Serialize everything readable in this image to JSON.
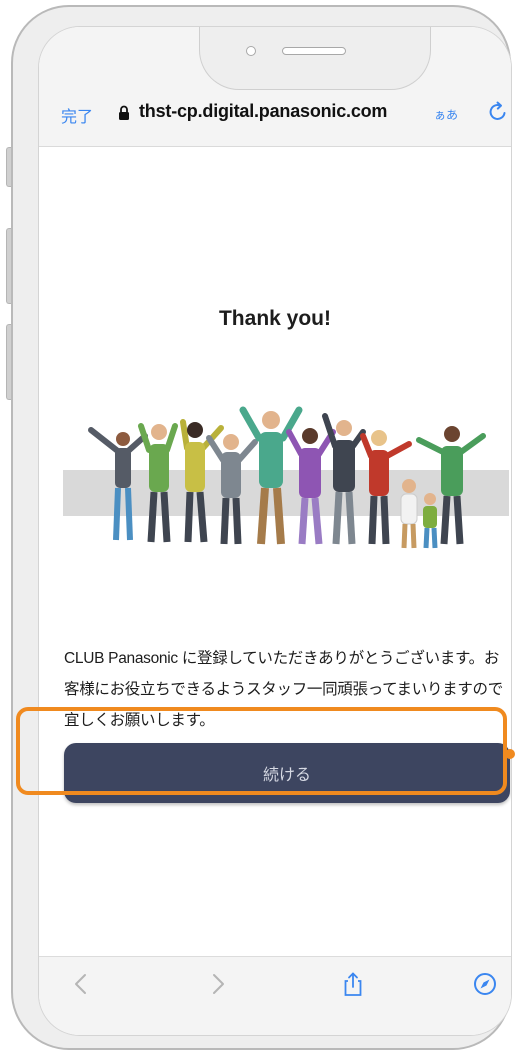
{
  "browser": {
    "done_label": "完了",
    "url": "thst-cp.digital.panasonic.com",
    "text_size_label": "ぁあ"
  },
  "page": {
    "title": "Thank you!",
    "message": "CLUB Panasonic に登録していただきありがとうございます。お客様にお役立ちできるようスタッフ一同頑張ってまいりますので宜しくお願いします。",
    "continue_label": "続ける"
  },
  "toolbar": {
    "icons": [
      "back-icon",
      "forward-icon",
      "share-icon",
      "compass-icon"
    ]
  },
  "colors": {
    "accent": "#3a86f0",
    "button": "#3d4560",
    "highlight": "#f08a1f"
  }
}
